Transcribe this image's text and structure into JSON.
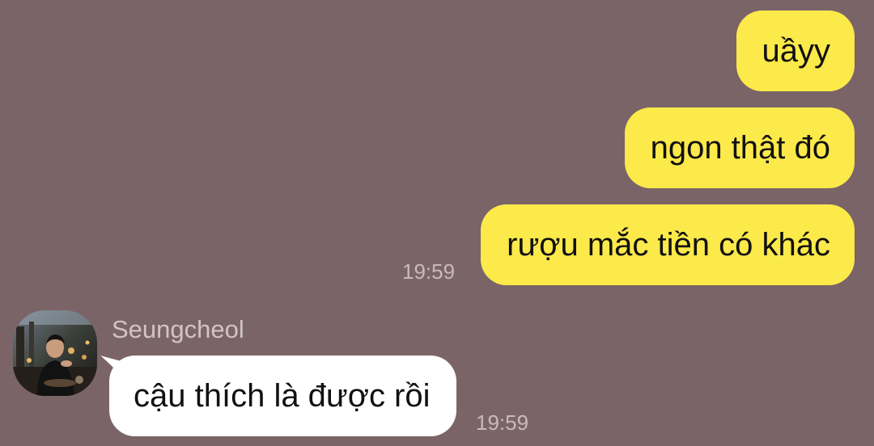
{
  "colors": {
    "background": "#7b6467",
    "sent_bubble": "#fce94a",
    "received_bubble": "#ffffff",
    "timestamp": "#c9b9bb",
    "sender_name": "#d2c3c5"
  },
  "messages": {
    "sent": [
      {
        "text": "uầyy"
      },
      {
        "text": "ngon thật đó"
      },
      {
        "text": "rượu mắc tiền có khác"
      }
    ],
    "sent_time": "19:59",
    "received": {
      "sender": "Seungcheol",
      "avatar_icon": "profile-photo-icon",
      "text": "cậu thích là được rồi",
      "time": "19:59"
    }
  }
}
